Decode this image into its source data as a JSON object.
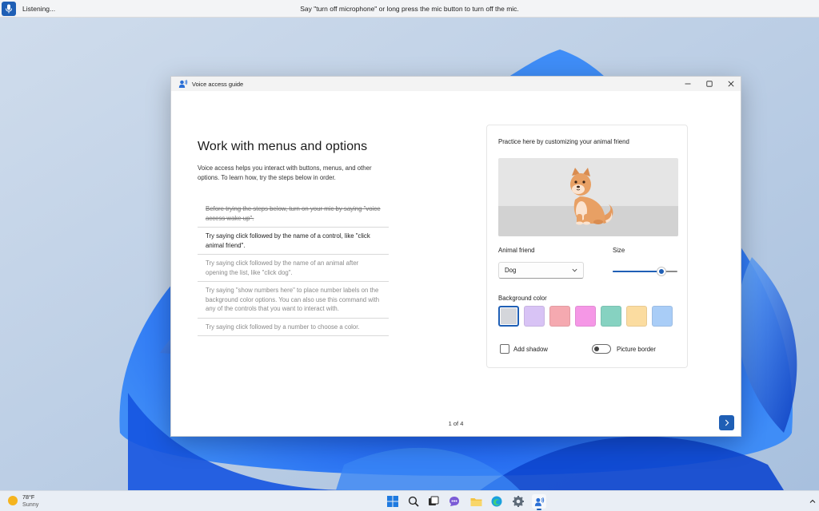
{
  "voice_bar": {
    "status": "Listening...",
    "hint": "Say \"turn off microphone\" or long press the mic button to turn off the mic.",
    "mic_icon": "microphone-icon",
    "accent": "#1f5fb5"
  },
  "window": {
    "title": "Voice access guide",
    "app_icon": "voice-access-icon",
    "controls": [
      "minimize-icon",
      "maximize-icon",
      "close-icon"
    ]
  },
  "lesson": {
    "title": "Work with menus and options",
    "intro": "Voice access helps you interact with buttons, menus, and other options. To learn how, try the steps below in order.",
    "steps": [
      {
        "text": "Before trying the steps below, turn on your mic by saying \"voice access wake up\".",
        "state": "done"
      },
      {
        "text": "Try saying click followed by the name of a control, like \"click animal friend\".",
        "state": "active"
      },
      {
        "text": "Try saying click followed by the name of an animal after opening the list, like \"click dog\".",
        "state": "pending"
      },
      {
        "text": "Try saying \"show numbers here\" to place number labels on the background color options. You can also use this command with any of the controls that you want to interact with.",
        "state": "pending"
      },
      {
        "text": "Try saying click followed by a number to choose a color.",
        "state": "pending"
      }
    ]
  },
  "practice": {
    "title": "Practice here by customizing your animal friend",
    "preview_background": "#e5e5e5",
    "animal_label": "Animal friend",
    "animal_value": "Dog",
    "size_label": "Size",
    "size_level": 0.75,
    "background_label": "Background color",
    "swatches": [
      {
        "color": "#d4d6db",
        "selected": true
      },
      {
        "color": "#d8c3f5",
        "selected": false
      },
      {
        "color": "#f5a9b0",
        "selected": false
      },
      {
        "color": "#f597e6",
        "selected": false
      },
      {
        "color": "#86d2c1",
        "selected": false
      },
      {
        "color": "#fbdca0",
        "selected": false
      },
      {
        "color": "#a9cdf7",
        "selected": false
      }
    ],
    "shadow_label": "Add shadow",
    "shadow_checked": false,
    "border_label": "Picture border",
    "border_on": false
  },
  "footer": {
    "page_indicator": "1 of 4",
    "next_icon": "chevron-right-icon"
  },
  "taskbar": {
    "weather_temp": "78°F",
    "weather_condition": "Sunny",
    "weather_icon": "sun-icon",
    "apps": [
      "windows-start-icon",
      "search-icon",
      "task-view-icon",
      "chat-icon",
      "file-explorer-icon",
      "edge-icon",
      "settings-icon",
      "voice-access-icon"
    ]
  }
}
